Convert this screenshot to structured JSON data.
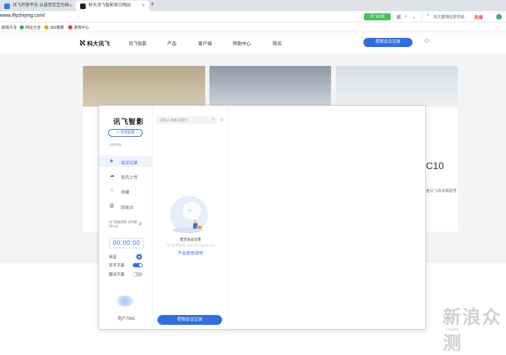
{
  "browser": {
    "tabs": [
      {
        "label": "讯飞开放平台-以语音交互为核..."
      },
      {
        "label": "科大讯飞智影官方网站"
      }
    ],
    "new_tab": "+",
    "url": "www.iflyzhiying.com/",
    "ext_button": "讯飞大师",
    "right_search_placeholder": "如大额捐住房供给",
    "right_search_hot": "热搜"
  },
  "bookmarks": [
    {
      "label": "游戏大全",
      "color": "#f5a623"
    },
    {
      "label": "网址大全",
      "color": "#2db84d"
    },
    {
      "label": "360搜索",
      "color": "#e8a010"
    },
    {
      "label": "游戏中心",
      "color": "#e53935"
    }
  ],
  "site": {
    "logo": "科大讯飞",
    "nav": [
      "讯飞智影",
      "产品",
      "客户端",
      "帮助中心",
      "购买"
    ],
    "nav_cta": "提取会议记录",
    "banner_big": "C10",
    "banner_small": "看讯飞寻求帮助号"
  },
  "watermark": {
    "main": "新浪众测",
    "sub": "什么值得买"
  },
  "app": {
    "title": "讯飞智影",
    "window_controls": [
      "—",
      "□",
      "✕"
    ],
    "screen_record_button": "无线投屏",
    "file_label": "文件列表",
    "sidebar": [
      {
        "label": "会议记录",
        "icon": "layers-icon",
        "active": true
      },
      {
        "label": "我的上传",
        "icon": "cloud-icon",
        "active": false
      },
      {
        "label": "收藏",
        "icon": "star-icon",
        "active": false
      },
      {
        "label": "回收站",
        "icon": "trash-icon",
        "active": false
      }
    ],
    "promo": "讯飞智能耳机 实时翻译AI10",
    "timer": "00:00:00",
    "options": [
      {
        "label": "录音",
        "type": "play"
      },
      {
        "label": "转写字幕",
        "on": true
      },
      {
        "label": "翻译字幕",
        "on": false
      }
    ],
    "username": "用户7941",
    "search_placeholder": "请输入搜索关键字",
    "empty_title": "暂无会议记录",
    "empty_hint": "讯飞智影官网：www.iflyzhiying.com",
    "empty_link": "产品使用说明",
    "bottom_cta": "提取会议记录",
    "accent": "#2f6ee3"
  }
}
